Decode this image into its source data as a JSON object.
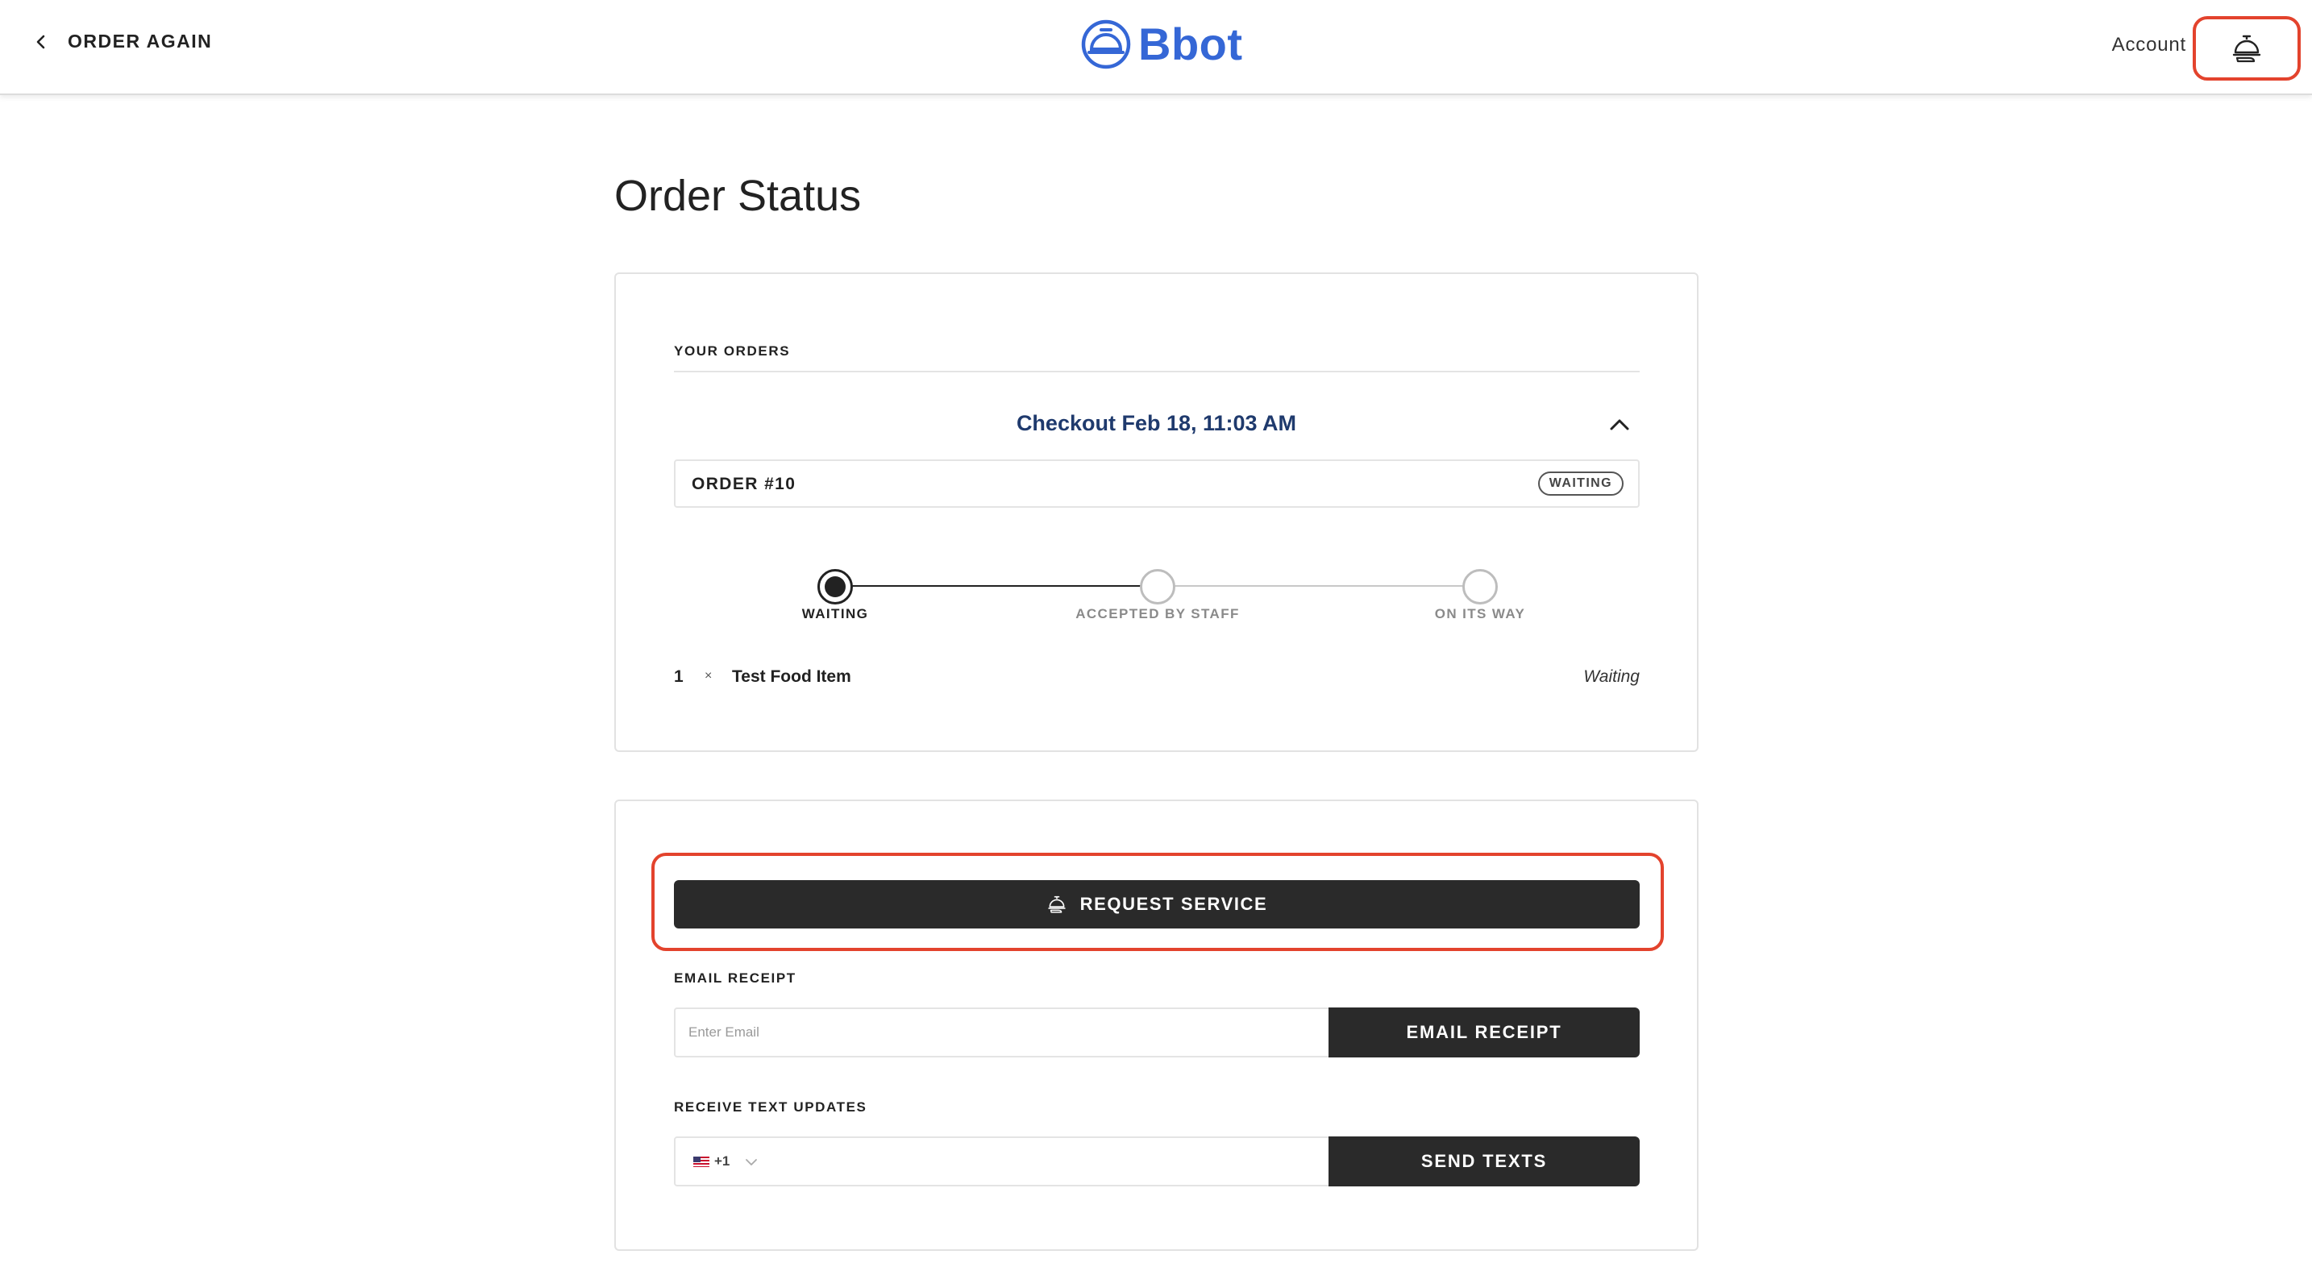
{
  "header": {
    "back_label": "ORDER AGAIN",
    "logo_text": "Bbot",
    "account_label": "Account",
    "brand_color": "#3567d6",
    "highlight_color": "#e3432d"
  },
  "page": {
    "title": "Order Status"
  },
  "orders": {
    "section_label": "YOUR ORDERS",
    "checkout_label": "Checkout Feb 18, 11:03 AM",
    "order_number": "ORDER #10",
    "status_badge": "WAITING",
    "steps": [
      {
        "label": "WAITING",
        "state": "active"
      },
      {
        "label": "ACCEPTED BY STAFF",
        "state": "pending"
      },
      {
        "label": "ON ITS WAY",
        "state": "pending"
      }
    ],
    "items": [
      {
        "qty": "1",
        "times": "×",
        "name": "Test Food Item",
        "status": "Waiting"
      }
    ]
  },
  "actions": {
    "request_service_label": "REQUEST SERVICE",
    "email_section_label": "EMAIL RECEIPT",
    "email_placeholder": "Enter Email",
    "email_button_label": "EMAIL RECEIPT",
    "text_section_label": "RECEIVE TEXT UPDATES",
    "country_code": "+1",
    "send_texts_label": "SEND TEXTS"
  },
  "icons": {
    "back": "chevron-left-icon",
    "service": "cloche-icon",
    "collapse": "chevron-up-icon",
    "country_dropdown": "chevron-down-icon",
    "flag": "us-flag-icon"
  }
}
